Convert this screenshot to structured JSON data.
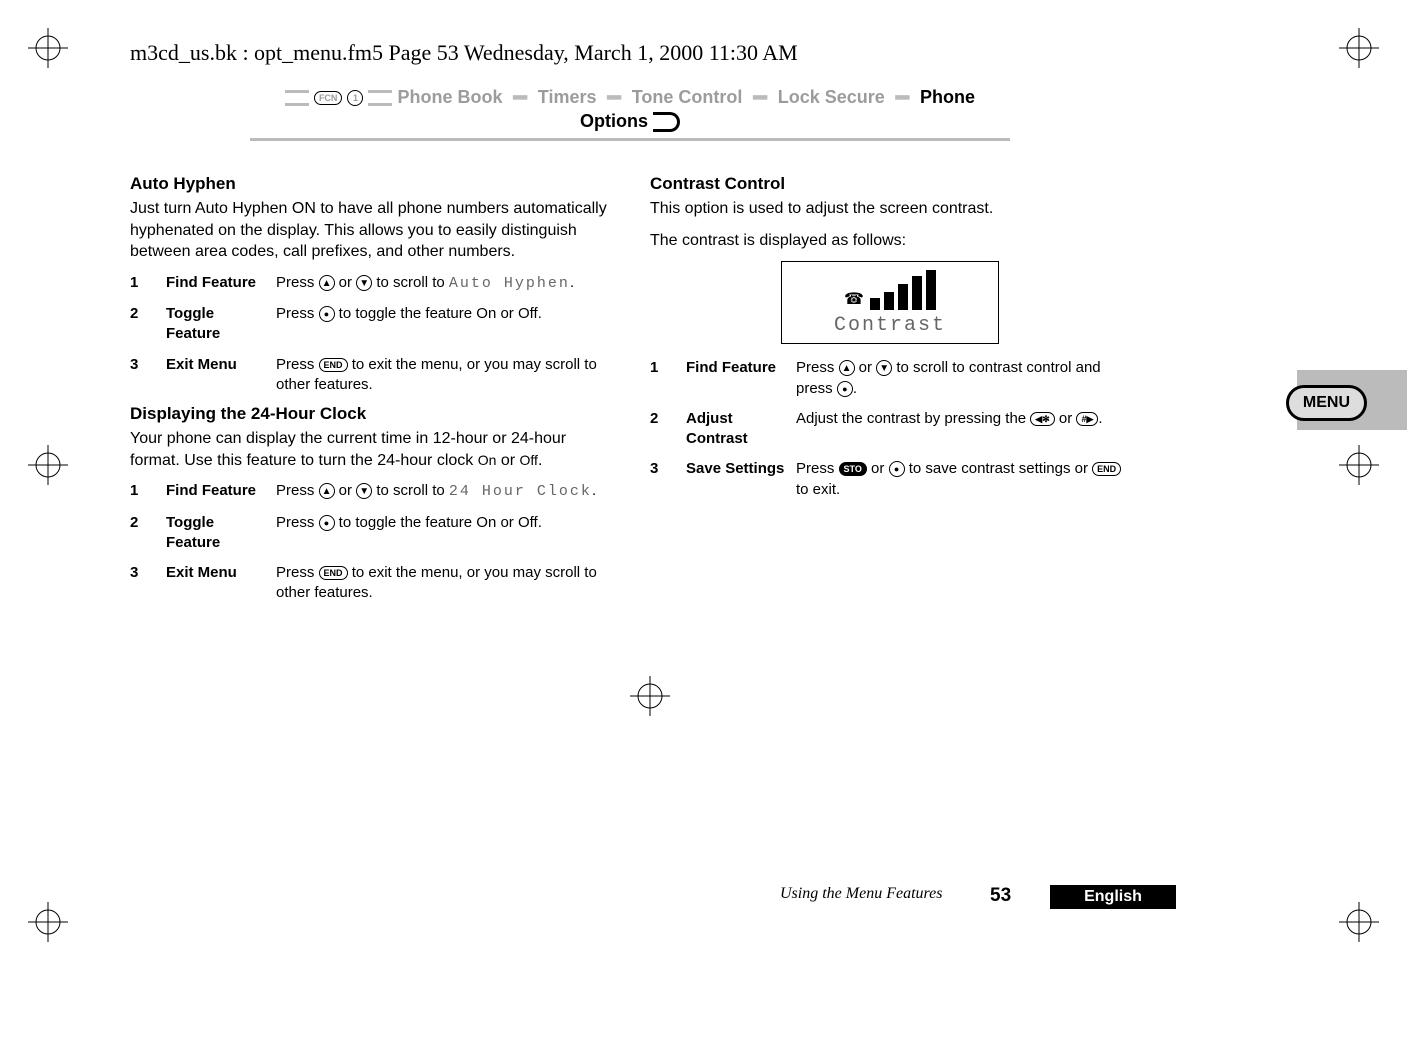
{
  "header": "m3cd_us.bk : opt_menu.fm5  Page 53  Wednesday, March 1, 2000  11:30 AM",
  "strip": {
    "items": [
      "Phone Book",
      "Timers",
      "Tone Control",
      "Lock Secure",
      "Phone Options"
    ],
    "fcn": "FCN",
    "one": "1"
  },
  "left": {
    "h1": "Auto Hyphen",
    "p1": "Just turn Auto Hyphen ON to have all phone numbers automatically hyphenated on the display. This allows you to easily distinguish between area codes, call prefixes, and other numbers.",
    "s": [
      {
        "n": "1",
        "l": "Find Feature",
        "t_pre": "Press ",
        "t_mid": " or ",
        "t_post": " to scroll to ",
        "lcd": "Auto Hyphen",
        "t_end": "."
      },
      {
        "n": "2",
        "l": "Toggle Feature",
        "t": "Press ",
        "t2": " to toggle the feature On or Off."
      },
      {
        "n": "3",
        "l": "Exit Menu",
        "t": "Press ",
        "btn": "END",
        "t2": " to exit the menu, or you may scroll to other features."
      }
    ],
    "h2": "Displaying the 24-Hour Clock",
    "p2_a": "Your phone can display the current time in 12-hour or 24-hour format. Use this feature to turn the 24-hour clock ",
    "p2_on": "On",
    "p2_or": " or ",
    "p2_off": "Off",
    "p2_end": ".",
    "s2": [
      {
        "n": "1",
        "l": "Find Feature",
        "t_pre": "Press ",
        "t_mid": " or ",
        "t_post": " to scroll to ",
        "lcd": "24 Hour Clock",
        "t_end": "."
      },
      {
        "n": "2",
        "l": "Toggle Feature",
        "t": "Press ",
        "t2": " to toggle the feature On or Off."
      },
      {
        "n": "3",
        "l": "Exit Menu",
        "t": "Press ",
        "btn": "END",
        "t2": " to exit the menu, or you may scroll to other features."
      }
    ]
  },
  "right": {
    "h1": "Contrast Control",
    "p1": "This option is used to adjust the screen contrast.",
    "p2": "The contrast is displayed as follows:",
    "lcd_label": "Contrast",
    "s": [
      {
        "n": "1",
        "l": "Find Feature",
        "t_pre": "Press ",
        "t_mid": " or ",
        "t_post": " to scroll to contrast control and press ",
        "t_end": "."
      },
      {
        "n": "2",
        "l": "Adjust Contrast",
        "t": "Adjust the contrast by pressing the ",
        "b1": "◀✻",
        "t2": " or ",
        "b2": "#▶",
        "t3": "."
      },
      {
        "n": "3",
        "l": "Save Settings",
        "t": "Press ",
        "b1": "STO",
        "t2": " or ",
        "t3": " to save contrast settings or ",
        "b3": "END",
        "t4": " to exit."
      }
    ]
  },
  "badge": "MENU",
  "footer": {
    "center": "Using the Menu Features",
    "page": "53",
    "lang": "English"
  }
}
